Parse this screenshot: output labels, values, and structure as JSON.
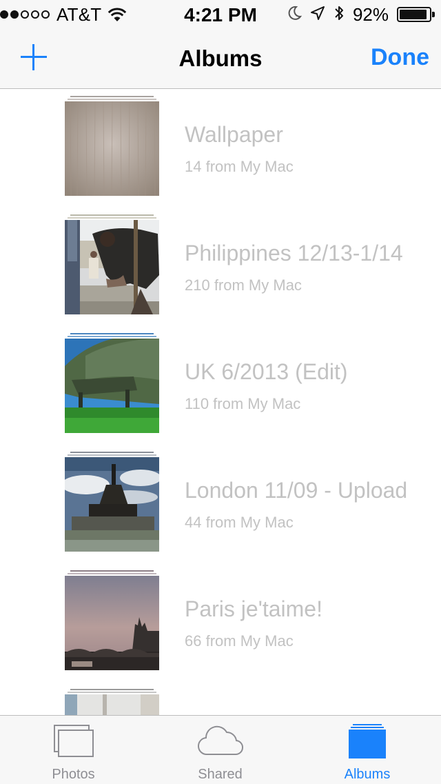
{
  "status_bar": {
    "carrier": "AT&T",
    "time": "4:21 PM",
    "battery_percent": "92%",
    "battery_level": 0.92,
    "signal_strength": 2,
    "signal_total": 5,
    "icons": [
      "wifi-icon",
      "moon-icon",
      "location-icon",
      "bluetooth-icon",
      "battery-icon"
    ]
  },
  "nav": {
    "title": "Albums",
    "done_label": "Done",
    "add_icon": "plus-icon",
    "accent_color": "#1a82fb"
  },
  "albums": [
    {
      "title": "Wallpaper",
      "count": "14 from My Mac",
      "thumb": "wood-texture"
    },
    {
      "title": "Philippines 12/13-1/14",
      "count": "210 from My Mac",
      "thumb": "people-working"
    },
    {
      "title": "UK 6/2013 (Edit)",
      "count": "110 from My Mac",
      "thumb": "mossy-bench"
    },
    {
      "title": "London 11/09 - Upload",
      "count": "44 from My Mac",
      "thumb": "monument"
    },
    {
      "title": "Paris je'taime!",
      "count": "66 from My Mac",
      "thumb": "paris-dusk"
    },
    {
      "title": "",
      "count": "",
      "thumb": "interior"
    }
  ],
  "tabs": [
    {
      "label": "Photos",
      "icon": "photos-icon",
      "active": false
    },
    {
      "label": "Shared",
      "icon": "cloud-icon",
      "active": false
    },
    {
      "label": "Albums",
      "icon": "albums-icon",
      "active": true
    }
  ],
  "colors": {
    "album_text": "#c2c2c2",
    "tab_inactive": "#8e8e93",
    "tab_active": "#1a82fb"
  }
}
